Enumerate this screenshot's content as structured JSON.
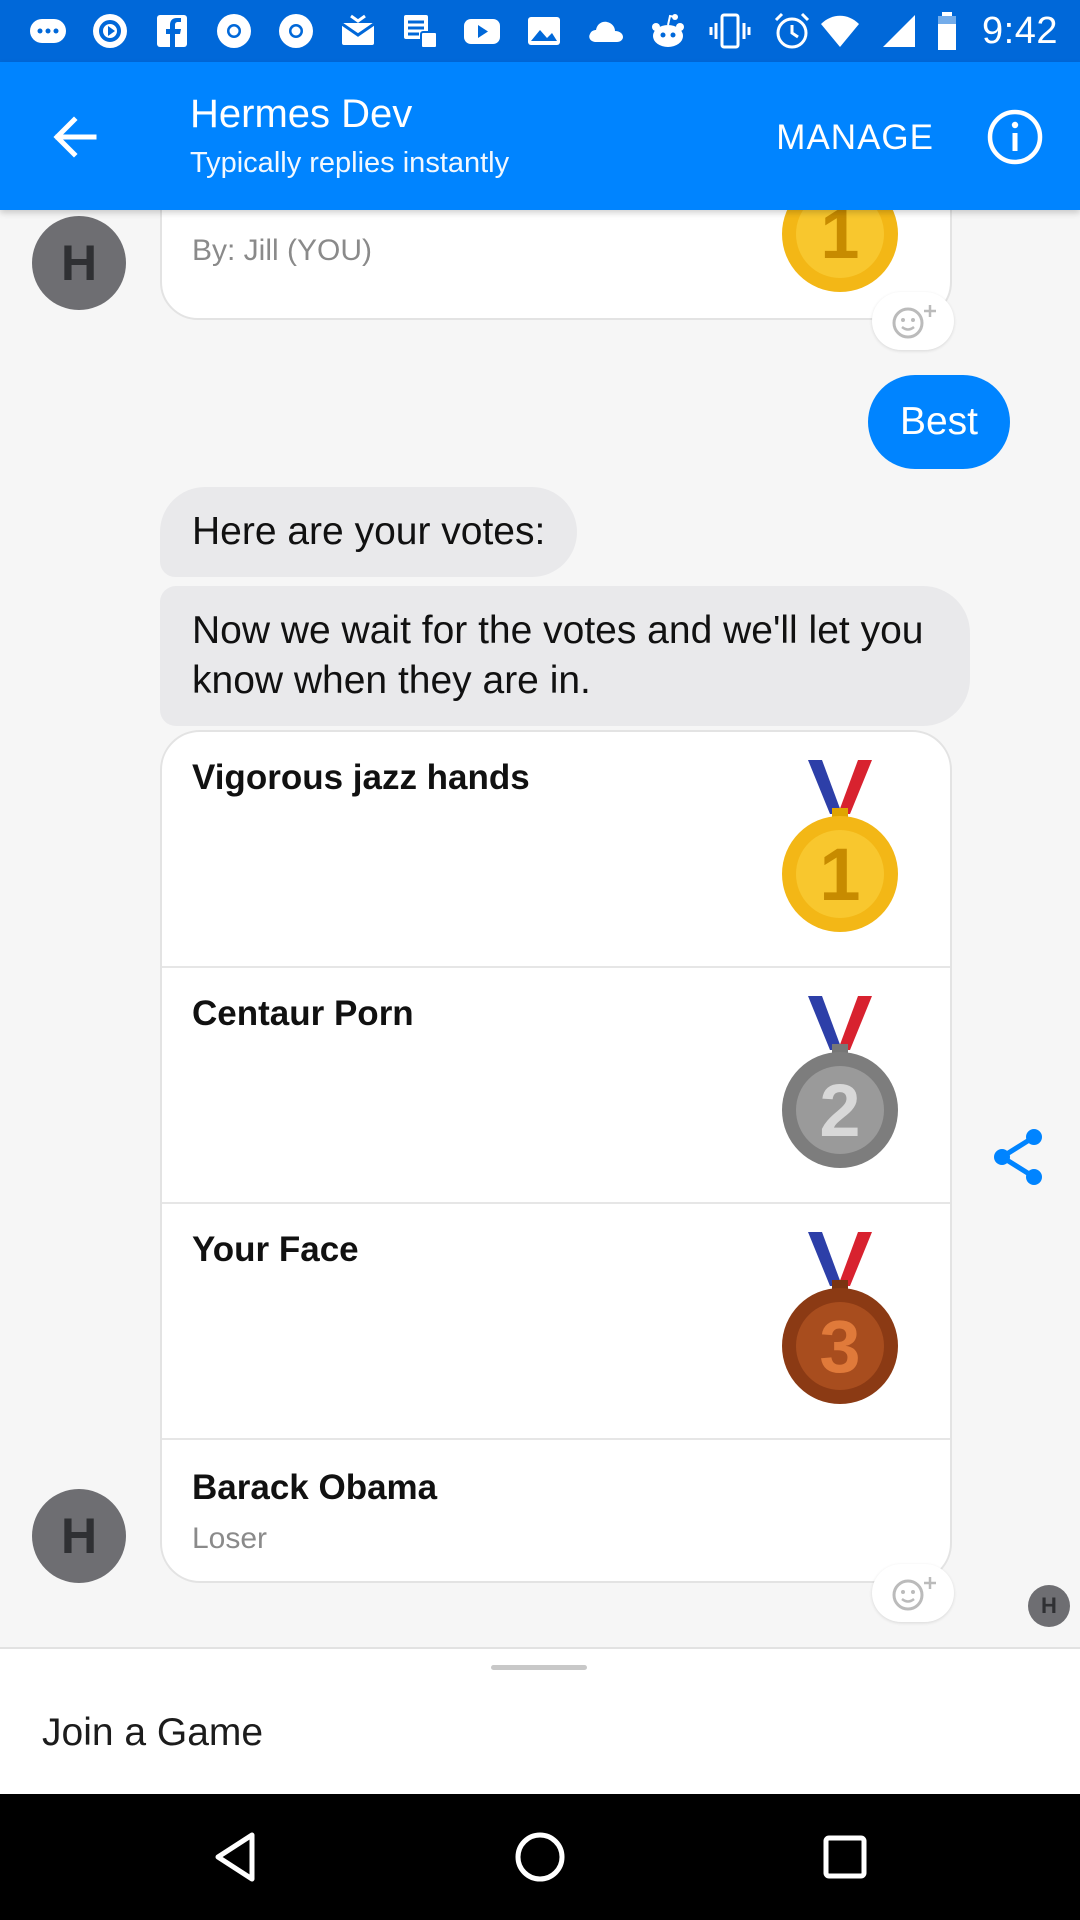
{
  "status_bar": {
    "time": "9:42",
    "icons": [
      "messenger-icon",
      "pocketcasts-icon",
      "facebook-icon",
      "chrome-icon",
      "chrome-icon",
      "mail-icon",
      "tasks-icon",
      "youtube-icon",
      "photos-icon",
      "cloud-icon",
      "reddit-icon",
      "vibrate-icon",
      "alarm-icon",
      "wifi-icon",
      "signal-icon",
      "battery-icon"
    ]
  },
  "header": {
    "title": "Hermes Dev",
    "subtitle": "Typically replies instantly",
    "manage_label": "MANAGE"
  },
  "chat": {
    "top_card_byline": "By: Jill (YOU)",
    "outgoing_message": "Best",
    "incoming_messages": [
      "Here are your votes:",
      "Now we wait for the votes and we'll let you know when they are in."
    ],
    "votes": [
      {
        "title": "Vigorous jazz hands",
        "medal": "1",
        "medal_color": "#f3b716"
      },
      {
        "title": "Centaur Porn",
        "medal": "2",
        "medal_color": "#8d8d8d"
      },
      {
        "title": "Your Face",
        "medal": "3",
        "medal_color": "#9a4317"
      }
    ],
    "last_entry": {
      "title": "Barack Obama",
      "subtitle": "Loser"
    },
    "avatar_letter": "H"
  },
  "composer": {
    "quick_reply": "Join a Game"
  },
  "colors": {
    "accent": "#0084ff",
    "status_bar": "#0068d9"
  }
}
